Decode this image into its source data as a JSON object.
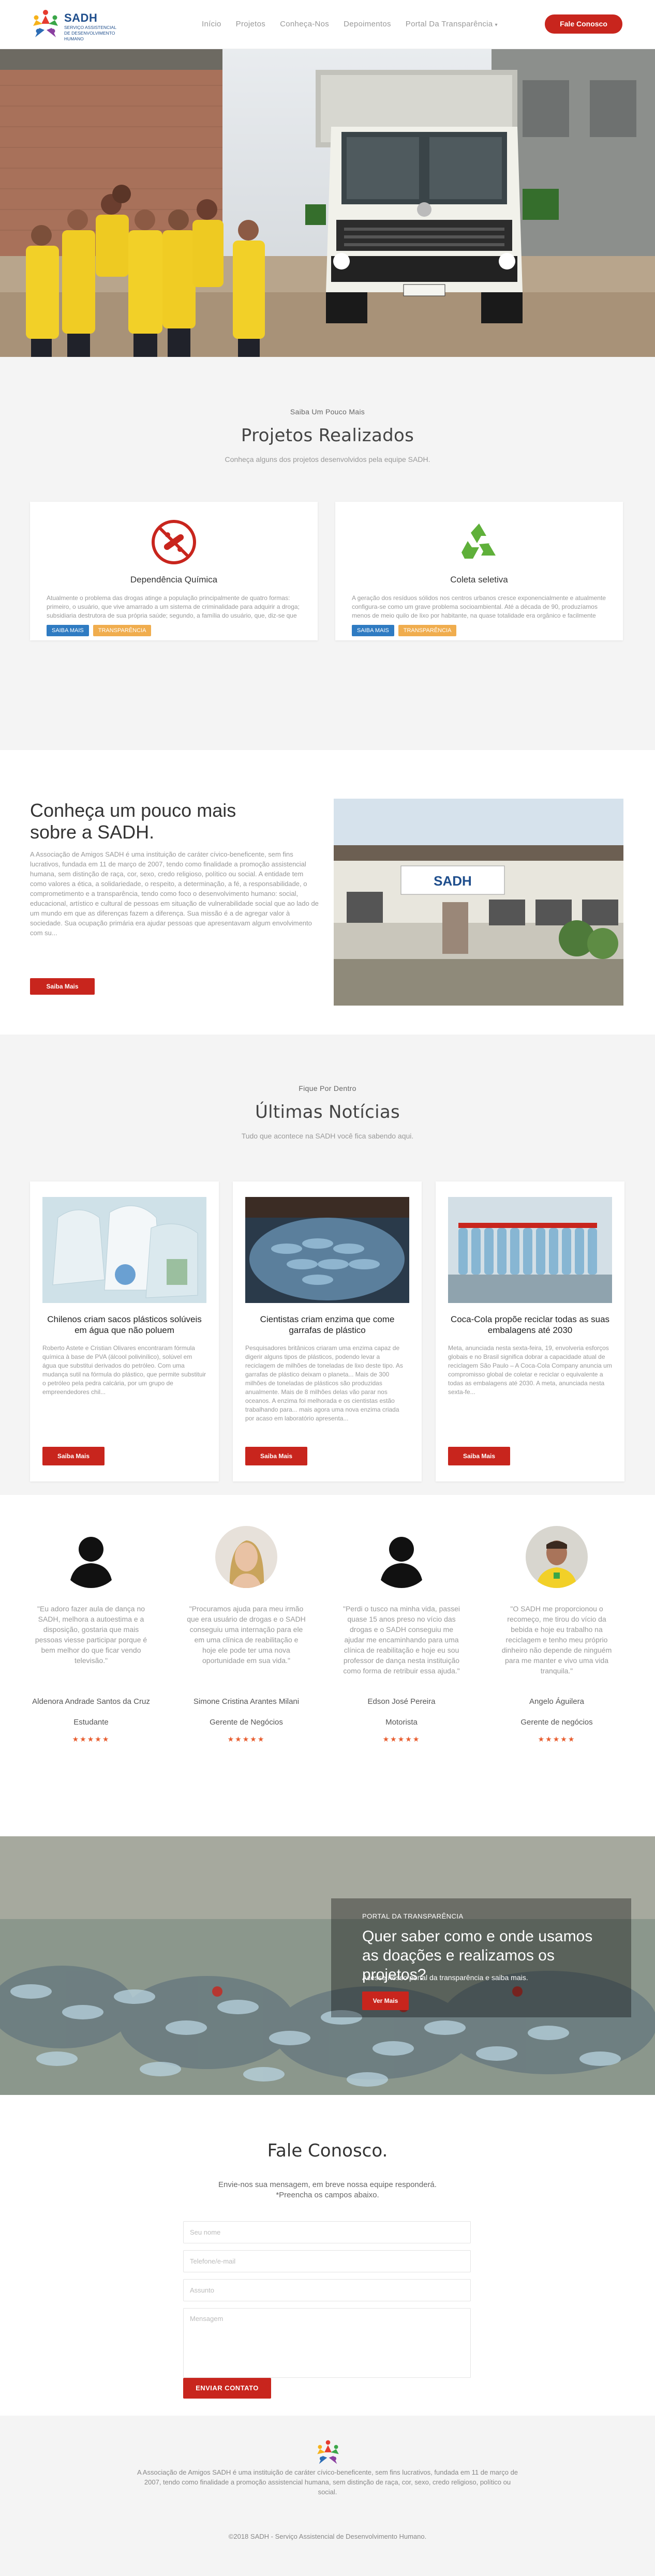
{
  "header": {
    "brand": "SADH",
    "brand_sub": "Serviço Assistencial de Desenvolvimento Humano",
    "nav": [
      {
        "label": "Início"
      },
      {
        "label": "Projetos"
      },
      {
        "label": "Conheça-Nos"
      },
      {
        "label": "Depoimentos"
      },
      {
        "label": "Portal Da Transparência"
      }
    ],
    "cta": "Fale Conosco"
  },
  "projects": {
    "eyebrow": "Saiba Um Pouco Mais",
    "title": "Projetos Realizados",
    "subtitle": "Conheça alguns dos projetos desenvolvidos pela equipe SADH.",
    "cards": [
      {
        "icon": "no-drugs-icon",
        "title": "Dependência Química",
        "text": "Atualmente o problema das drogas atinge a população principalmente de quatro formas: primeiro, o usuário, que vive amarrado a um sistema de criminalidade para adquirir a droga; subsidiaria destrutora de sua própria saúde; segundo, a família do usuário, que, diz-se que dos acompanha tudo e só...",
        "btn1": "SAIBA MAIS",
        "btn2": "TRANSPARÊNCIA"
      },
      {
        "icon": "recycle-icon",
        "title": "Coleta seletiva",
        "text": "A geração dos resíduos sólidos nos centros urbanos cresce exponencialmente e atualmente configura-se como um grave problema socioambiental. Até a década de 90, produzíamos menos de meio quilo de lixo por habitante, na quase totalidade era orgânico e facilmente absorvido pela natureza. Hoje...",
        "btn1": "SAIBA MAIS",
        "btn2": "TRANSPARÊNCIA"
      }
    ]
  },
  "about": {
    "title": "Conheça um pouco mais sobre a SADH.",
    "text": "A Associação de Amigos SADH é uma instituição de caráter cívico-beneficente, sem fins lucrativos, fundada em 11 de março de 2007, tendo como finalidade a promoção assistencial humana, sem distinção de raça, cor, sexo, credo religioso, político ou social. A entidade tem como valores a ética, a solidariedade, o respeito, a determinação, a fé, a responsabilidade, o comprometimento e a transparência, tendo como foco o desenvolvimento humano: social, educacional, artístico e cultural de pessoas em situação de vulnerabilidade social que ao lado de um mundo em que as diferenças fazem a diferença. Sua missão é a de agregar valor à sociedade. Sua ocupação primária era ajudar pessoas que apresentavam algum envolvimento com su...",
    "button": "Saiba Mais",
    "photo_sign": "SADH"
  },
  "news": {
    "eyebrow": "Fique Por Dentro",
    "title": "Últimas Notícias",
    "subtitle": "Tudo que acontece na SADH você fica sabendo aqui.",
    "items": [
      {
        "title": "Chilenos criam sacos plásticos solúveis em água que não poluem",
        "text": "Roberto Astete e Cristian Olivares encontraram fórmula química à base de PVA (álcool polivinílico), solúvel em água que substitui derivados do petróleo. Com uma mudança sutil na fórmula do plástico, que permite substituir o petróleo pela pedra calcária, por um grupo de empreendedores chil...",
        "button": "Saiba Mais"
      },
      {
        "title": "Cientistas criam enzima que come garrafas de plástico",
        "text": "Pesquisadores britânicos criaram uma enzima capaz de digerir alguns tipos de plásticos, podendo levar a reciclagem de milhões de toneladas de lixo deste tipo. As garrafas de plástico deixam o planeta... Mais de 300 milhões de toneladas de plásticos são produzidas anualmente. Mais de 8 milhões delas vão parar nos oceanos. A enzima foi melhorada e os cientistas estão trabalhando para... mais agora uma nova enzima criada por acaso em laboratório apresenta...",
        "button": "Saiba Mais"
      },
      {
        "title": "Coca-Cola propõe reciclar todas as suas embalagens até 2030",
        "text": "Meta, anunciada nesta sexta-feira, 19, envolveria esforços globais e no Brasil significa dobrar a capacidade atual de reciclagem São Paulo – A Coca-Cola Company anuncia um compromisso global de coletar e reciclar o equivalente a todas as embalagens até 2030. A meta, anunciada nesta sexta-fe...",
        "button": "Saiba Mais"
      }
    ]
  },
  "testimonials": [
    {
      "quote": "\"Eu adoro fazer aula de dança no SADH, melhora a autoestima e a disposição, gostaria que mais pessoas viesse participar porque é bem melhor do que ficar vendo televisão.\"",
      "name": "Aldenora Andrade Santos da Cruz",
      "role": "Estudante",
      "stars": "★★★★★",
      "avatar": "silhouette"
    },
    {
      "quote": "\"Procuramos ajuda para meu irmão que era usuário de drogas e o SADH conseguiu uma internação para ele em uma clínica de reabilitação e hoje ele pode ter uma nova oportunidade em sua vida.\"",
      "name": "Simone Cristina Arantes Milani",
      "role": "Gerente de Negócios",
      "stars": "★★★★★",
      "avatar": "photo-woman"
    },
    {
      "quote": "\"Perdi o tusco na minha vida, passei quase 15 anos preso no vício das drogas e o SADH conseguiu me ajudar me encaminhando para uma clínica de reabilitação e hoje eu sou professor de dança nesta instituição como forma de retribuir essa ajuda.\"",
      "name": "Edson José Pereira",
      "role": "Motorista",
      "stars": "★★★★★",
      "avatar": "silhouette"
    },
    {
      "quote": "\"O SADH me proporcionou o recomeço, me tirou do vício da bebida e hoje eu trabalho na reciclagem e tenho meu próprio dinheiro não depende de ninguém para me manter e vivo uma vida tranquila.\"",
      "name": "Angelo Águilera",
      "role": "Gerente de negócios",
      "stars": "★★★★★",
      "avatar": "photo-man"
    }
  ],
  "banner": {
    "eyebrow": "Portal da Transparência",
    "title": "Quer saber como e onde usamos as doações e realizamos os projetos?",
    "text": "Acesse nosso portal da transparência e saiba mais.",
    "button": "Ver Mais"
  },
  "contact": {
    "title": "Fale Conosco.",
    "intro_1": "Envie-nos sua mensagem, em breve nossa equipe responderá.",
    "intro_2": "*Preencha os campos abaixo.",
    "placeholders": {
      "name": "Seu nome",
      "phone": "Telefone/e-mail",
      "subject": "Assunto",
      "message": "Mensagem"
    },
    "button": "ENVIAR CONTATO"
  },
  "footer": {
    "text": "A Associação de Amigos SADH é uma instituição de caráter cívico-beneficente, sem fins lucrativos, fundada em 11 de março de 2007, tendo como finalidade a promoção assistencial humana, sem distinção de raça, cor, sexo, credo religioso, político ou social.",
    "copyright": "©2018 SADH - Serviço Assistencial de Desenvolvimento Humano."
  },
  "colors": {
    "accent_red": "#c8251d",
    "blue_button": "#2f7bc2",
    "orange_button": "#f0ad4e",
    "brand_blue": "#1f4e8c",
    "stars": "#e85d2f"
  }
}
